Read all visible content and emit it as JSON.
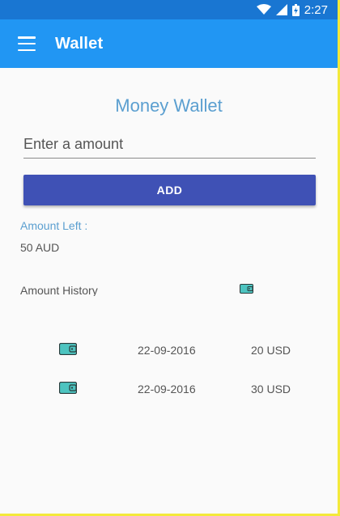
{
  "status_bar": {
    "time": "2:27"
  },
  "app_bar": {
    "title": "Wallet"
  },
  "main": {
    "heading": "Money Wallet",
    "amount_placeholder": "Enter a amount",
    "add_label": "ADD",
    "amount_left_label": "Amount Left :",
    "amount_left_value": "50 AUD",
    "history_label": "Amount History"
  },
  "history": [
    {
      "icon": "wallet-icon",
      "date": "22-09-2016",
      "amount": "20 USD"
    },
    {
      "icon": "wallet-icon",
      "date": "22-09-2016",
      "amount": "30 USD"
    }
  ],
  "colors": {
    "status_bar": "#1976d2",
    "app_bar": "#2196f3",
    "accent_text": "#5b9fd0",
    "button": "#3f51b5",
    "wallet_icon": "#4dc4c0"
  }
}
